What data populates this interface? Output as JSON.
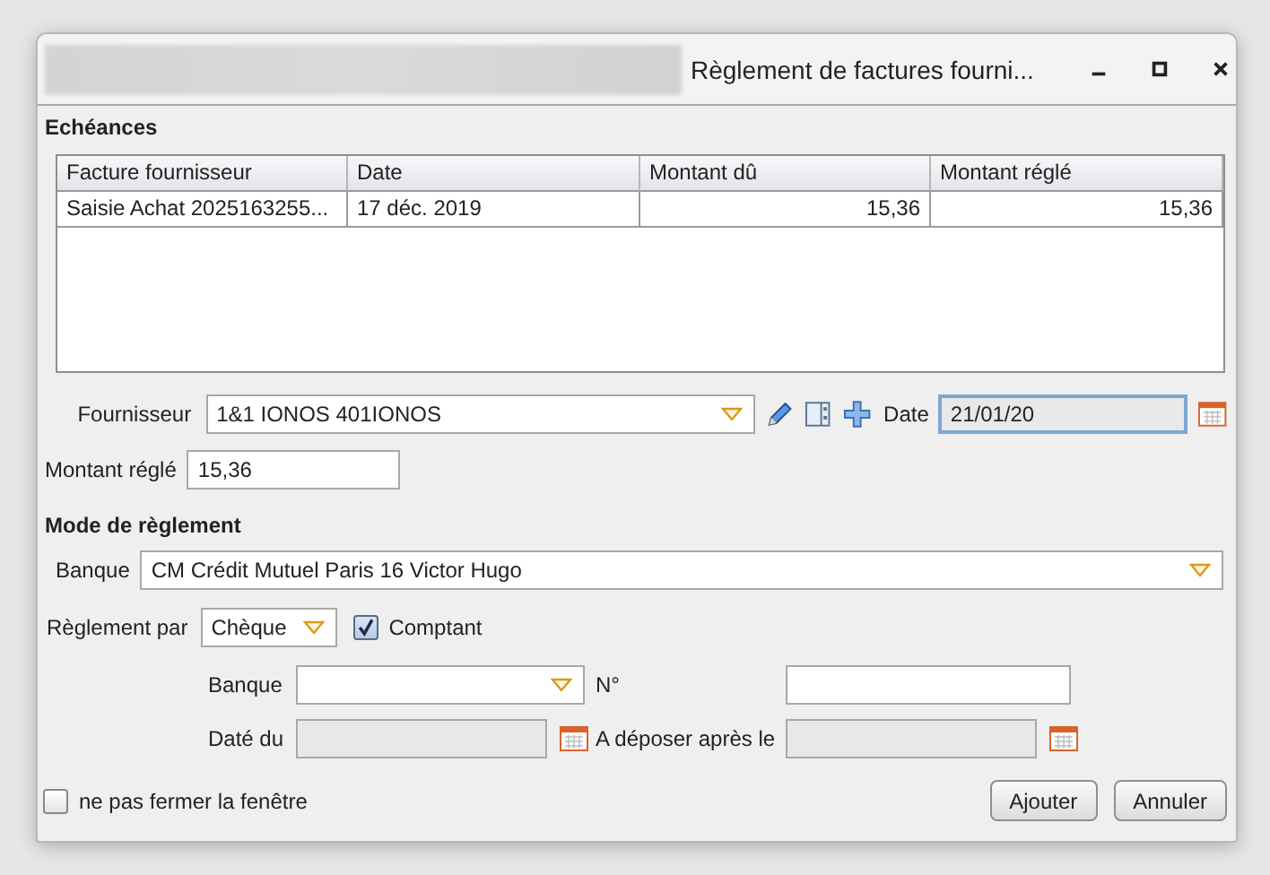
{
  "window": {
    "title": "Règlement de factures fourni..."
  },
  "echeances": {
    "title": "Echéances",
    "columns": [
      {
        "label": "Facture fournisseur"
      },
      {
        "label": "Date"
      },
      {
        "label": "Montant dû"
      },
      {
        "label": "Montant réglé"
      }
    ],
    "rows": [
      {
        "selected": false,
        "cells": [
          "Saisie Achat 2025163255...",
          "17 déc. 2019",
          "15,36",
          "15,36"
        ]
      }
    ]
  },
  "fournisseur": {
    "label": "Fournisseur",
    "value": "1&1 IONOS 401IONOS",
    "date_label": "Date",
    "date_value": "21/01/20",
    "date_focused": true
  },
  "montant": {
    "label": "Montant réglé",
    "value": "15,36"
  },
  "mode": {
    "title": "Mode de règlement",
    "banque": {
      "label": "Banque",
      "value": "CM Crédit Mutuel Paris 16 Victor Hugo"
    },
    "reglement": {
      "label": "Règlement par",
      "value": "Chèque",
      "comptant_label": "Comptant",
      "comptant_checked": true
    },
    "cheque": {
      "banque_label": "Banque",
      "numero_label": "N°",
      "date_label": "Daté du",
      "date_disabled": true,
      "deposer_label": "A déposer après le",
      "deposer_disabled": true
    }
  },
  "footer": {
    "keep_open_label": "ne pas fermer la fenêtre",
    "keep_open_checked": false,
    "buttons": [
      "Ajouter",
      "Annuler"
    ]
  }
}
